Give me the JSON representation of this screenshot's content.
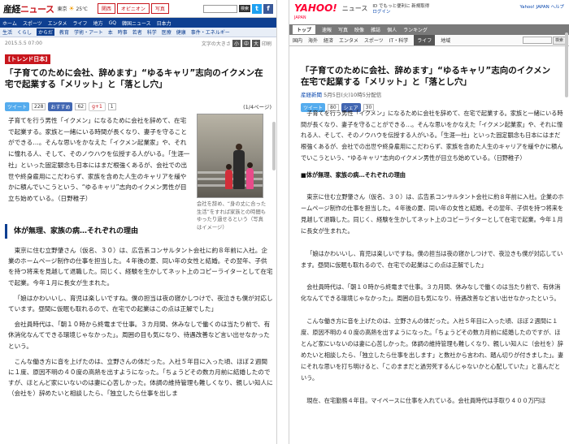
{
  "left": {
    "logo_a": "産経",
    "logo_b": "ニュース",
    "weather_city": "東京",
    "weather_temp": "25℃",
    "tabs": [
      "関西",
      "オピニオン",
      "写真"
    ],
    "search_button": "検索",
    "social": [
      "t",
      "f"
    ],
    "nav_primary": [
      "ホーム",
      "スポーツ",
      "エンタメ",
      "ライフ",
      "地方",
      "GQ",
      "韓国ニュース",
      "日本力"
    ],
    "nav_secondary": [
      "生活",
      "くらし",
      "からだ",
      "教育",
      "学術・アート",
      "本",
      "時事",
      "若者",
      "科学",
      "医療",
      "健康",
      "事件・エネルギー",
      "特集",
      "写真",
      "ランキング"
    ],
    "nav_secondary_active": "からだ",
    "date": "2015.5.5 07:00",
    "size_label": "文字の大きさ",
    "size_buttons": [
      "小",
      "中",
      "大"
    ],
    "print_label": "印刷",
    "badge": "[トレンド日本]",
    "title": "「子育てのために会社、辞めます」“ゆるキャリ”志向のイクメン在宅で起業する「メリット」と「落とし穴」",
    "share": {
      "tweet": "ツイート",
      "tweet_count": "228",
      "fb_label": "おすすめ",
      "fb_count": "62",
      "gplus": "g+1",
      "gplus_count": "1"
    },
    "page_indicator": "(1/4ページ)",
    "lead": "子育てを行う男性「イクメン」になるために会社を辞めて、在宅で起業する。家族と一緒にいる時間が長くなり、妻子を守ることができる…。そんな思いをかなえた「イクメン起業家」や、それに憧れる人、そして、そのノウハウを伝授する人がいる。「生涯一社」といった固定観念も日本にはまだ根強くあるが、会社での出世や終身雇用にこだわらず、家族を含めた人生のキャリアを緩やかに積んでいこうという、“ゆるキャリ”志向のイクメン男性が目立ち始めている。（日野稚子）",
    "caption": "会社を辞め、“身の丈に合った生活”をすれば家族との時間もゆったり過せるという（写真はイメージ）",
    "section_heading": "体が無理、家族の病…それぞれの理由",
    "body": [
      "東京に住む立野肇さん（仮名、３０）は、広告系コンサルタント会社に約８年前に入社。企業のホームページ制作の仕事を担当した。４年後の夏、同い年の女性と結婚。その翌年、子供を持つ将来を見越して退職した。同じく、経験を生かしてネット上のコピーライターとして在宅で起業。今年１月に長女が生まれた。",
      "「娘はかわいいし、育児は楽しいですね。僕の担当は夜の寝かしつけで、夜泣きも僕が対応しています。昼間に仮眠も取れるので、在宅での起業はこの点は正解でした」",
      "会社員時代は、「朝１０時から終電まで仕事。３カ月間、休みなしで働くのは当たり前で、有休消化なんてできる環境じゃなかった」。周囲の目も気になり、待遇改善など言い出せなかったという。",
      "こんな働き方に音を上げたのは、立野さんの体だった。入社５年目に入った頃、ほぼ２週間に１度、原因不明の４０度の高熱を出すようになった。「ちょうどその数カ月前に結婚したのですが、ほとんど家にいないのは妻に心苦しかった。体調の維持管理も難しくなり、親しい知人に（会社を）辞めたいと相談したら、「独立したら仕事を出しま"
    ]
  },
  "right": {
    "logo": "YAHOO!",
    "logo_sub": "JAPAN",
    "news_label": "ニュース",
    "top_links": "ID でもっと便利に 新規取得",
    "login_link": "ログイン",
    "help_links": "Yahoo! JAPAN ヘルプ",
    "nav_primary": [
      "トップ",
      "速報",
      "写真",
      "映像",
      "雑誌",
      "個人",
      "ランキング"
    ],
    "nav_primary_active": "トップ",
    "nav_secondary": [
      "国内",
      "海外",
      "経済",
      "エンタメ",
      "スポーツ",
      "IT・科学",
      "ライフ",
      "地域"
    ],
    "nav_secondary_active": "ライフ",
    "search_button": "検索",
    "title": "「子育てのために会社、辞めます」“ゆるキャリ”志向のイクメン　在宅で起業する「メリット」と「落とし穴」",
    "source": "産経新聞",
    "posted": "5月5日(火)10時5分配信",
    "share": {
      "tweet": "ツイート",
      "tweet_count": "80",
      "fb_label": "シェア",
      "fb_count": "30"
    },
    "lead": "子育てを行う男性「イクメン」になるために会社を辞めて、在宅で起業する。家族と一緒にいる時間が長くなり、妻子を守ることができる…。そんな思いをかなえた「イクメン起業家」や、それに憧れる人、そして、そのノウハウを伝授する人がいる。「生涯一社」といった固定観念も日本にはまだ根強くあるが、会社での出世や終身雇用にこだわらず、家族を含めた人生のキャリアを緩やかに積んでいこうという、“ゆるキャリ”志向のイクメン男性が目立ち始めている。（日野稚子）",
    "section_heading": "■体が無理、家族の病…それぞれの理由",
    "body": [
      "東京に住む立野肇さん（仮名、３０）は、広告系コンサルタント会社に約８年前に入社。企業のホームページ制作の仕事を担当した。４年後の夏、同い年の女性と結婚。その翌年、子供を持つ将来を見越して退職した。同じく、経験を生かしてネット上のコピーライターとして在宅で起業。今年１月に長女が生まれた。",
      "「娘はかわいいし、育児は楽しいですね。僕の担当は夜の寝かしつけで、夜泣きも僕が対応しています。昼間に仮眠も取れるので、在宅での起業はこの点は正解でした」",
      "会社員時代は、「朝１０時から終電まで仕事。３カ月間、休みなしで働くのは当たり前で、有休消化なんてできる環境じゃなかった」。周囲の目も気になり、待遇改善など言い出せなかったという。",
      "こんな働き方に音を上げたのは、立野さんの体だった。入社５年目に入った頃、ほぼ２週間に１度、原因不明の４０度の高熱を出すようになった。「ちょうどその数カ月前に結婚したのですが、ほとんど家にいないのは妻に心苦しかった。体調の維持管理も難しくなり、親しい知人に（会社を）辞めたいと相談したら、「独立したら仕事を出します」と数社から言われ、踏ん切りが付きました」。妻にそれな思いを打ち明けると、「このままだと過労死するんじゃないかと心配していた」と喜んだという。",
      "現在、在宅勤務４年目。マイペースに仕事を入れている。会社員時代は手取り４００万円ほ"
    ]
  }
}
